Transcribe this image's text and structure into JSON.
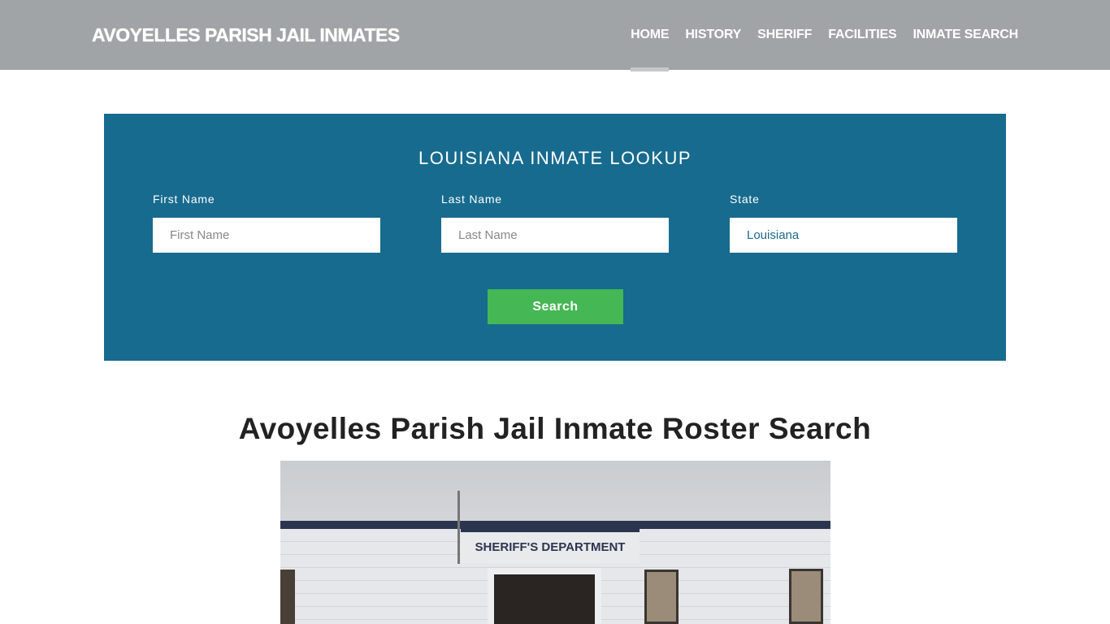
{
  "header": {
    "title": "AVOYELLES PARISH JAIL INMATES",
    "nav": [
      {
        "label": "HOME",
        "active": true
      },
      {
        "label": "HISTORY"
      },
      {
        "label": "SHERIFF"
      },
      {
        "label": "FACILITIES"
      },
      {
        "label": "INMATE SEARCH"
      }
    ]
  },
  "lookup": {
    "heading": "LOUISIANA INMATE LOOKUP",
    "first_name": {
      "label": "First Name",
      "placeholder": "First Name"
    },
    "last_name": {
      "label": "Last Name",
      "placeholder": "Last Name"
    },
    "state": {
      "label": "State",
      "value": "Louisiana"
    },
    "search_label": "Search"
  },
  "main": {
    "title": "Avoyelles Parish Jail Inmate Roster Search"
  },
  "photo": {
    "sign_text": "SHERIFF'S  DEPARTMENT"
  },
  "colors": {
    "header": "#a0a4a6",
    "panel": "#176b8e",
    "button": "#45b754"
  }
}
